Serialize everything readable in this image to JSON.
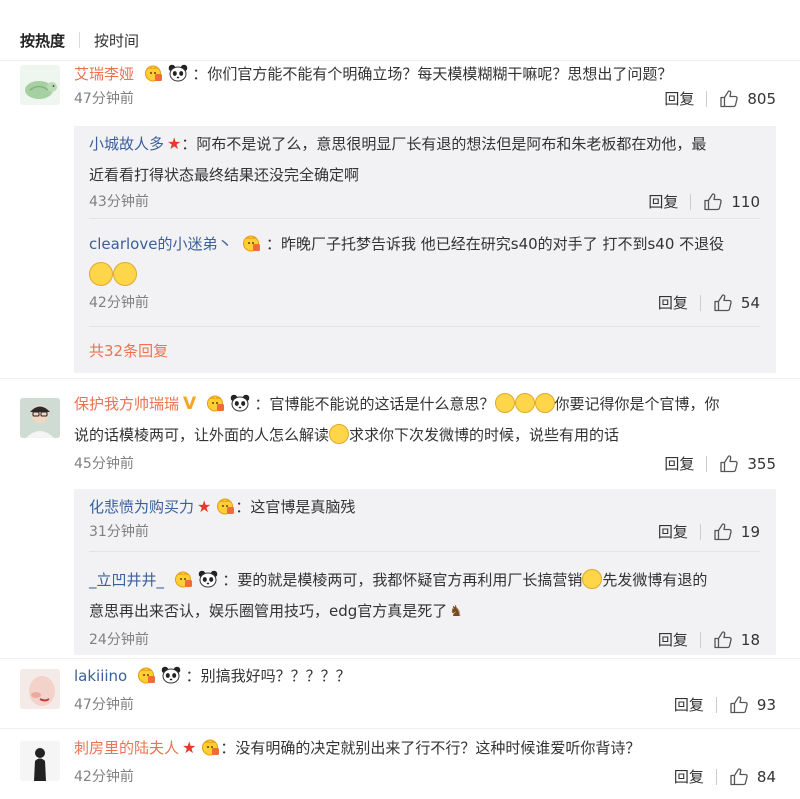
{
  "tabs": {
    "hot": "按热度",
    "time": "按时间"
  },
  "comments": [
    {
      "user": "艾瑞李娅",
      "text": "：你们官方能不能有个明确立场？每天模模糊糊干嘛呢？思想出了问题？",
      "time": "47分钟前",
      "reply_label": "回复",
      "likes": "805",
      "replies": [
        {
          "user": "小城故人多",
          "text1": "：阿布不是说了么，意思很明显厂长有退的想法但是阿布和朱老板都在劝他，最",
          "text2": "近看看打得状态最终结果还没完全确定啊",
          "time": "43分钟前",
          "reply_label": "回复",
          "likes": "110"
        },
        {
          "user": "clearlove的小迷弟丶",
          "text1": "：昨晚厂子托梦告诉我 他已经在研究s40的对手了 打不到s40 不退役",
          "time": "42分钟前",
          "reply_label": "回复",
          "likes": "54"
        }
      ],
      "more_replies": "共32条回复"
    },
    {
      "user": "保护我方帅瑞瑞",
      "text1a": "：官博能不能说的这话是什么意思？",
      "text1b": "你要记得你是个官博，你",
      "text2a": "说的话模棱两可，让外面的人怎么解读",
      "text2b": "求求你下次发微博的时候，说些有用的话",
      "time": "45分钟前",
      "reply_label": "回复",
      "likes": "355",
      "replies": [
        {
          "user": "化悲愤为购买力",
          "text1": "：这官博是真脑残",
          "time": "31分钟前",
          "reply_label": "回复",
          "likes": "19"
        },
        {
          "user": "_立凹井井_",
          "text1a": "：要的就是模棱两可，我都怀疑官方再利用厂长搞营销",
          "text1b": "先发微博有退的",
          "text2": "意思再出来否认，娱乐圈管用技巧，edg官方真是死了",
          "time": "24分钟前",
          "reply_label": "回复",
          "likes": "18"
        }
      ]
    },
    {
      "user": "lakiiino",
      "text": "：别搞我好吗？？？？？",
      "time": "47分钟前",
      "reply_label": "回复",
      "likes": "93"
    },
    {
      "user": "刺房里的陆夫人",
      "text": "：没有明确的决定就别出来了行不行？这种时候谁爱听你背诗？",
      "time": "42分钟前",
      "reply_label": "回复",
      "likes": "84"
    }
  ],
  "colors": {
    "username": "#eb7350",
    "link": "#3a5f9a",
    "reply_bg": "#f2f2f5",
    "meta": "#808080"
  },
  "icons": [
    "thumbs-up-icon",
    "crown-badge-icon",
    "panda-icon",
    "star-icon",
    "v-badge-icon",
    "emoji-icon",
    "horse-icon"
  ]
}
